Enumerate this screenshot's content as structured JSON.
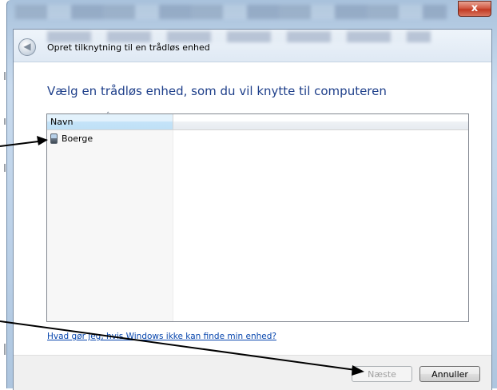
{
  "window": {
    "close_glyph": "x",
    "title": "Opret tilknytning til en trådløs enhed",
    "back_glyph": "◀"
  },
  "instruction": "Vælg en trådløs enhed, som du vil knytte til computeren",
  "listview": {
    "columns": [
      "Navn"
    ],
    "sort_glyph": "ˆ",
    "items": [
      {
        "label": "Boerge",
        "icon": "mobile-phone-icon"
      }
    ]
  },
  "help_link": "Hvad gør jeg, hvis Windows ikke kan finde min enhed?",
  "buttons": {
    "next": "Næste",
    "cancel": "Annuller"
  },
  "colors": {
    "instruction_text": "#1e3f8a",
    "link": "#0645ad",
    "annotation_arrow": "#000000"
  }
}
